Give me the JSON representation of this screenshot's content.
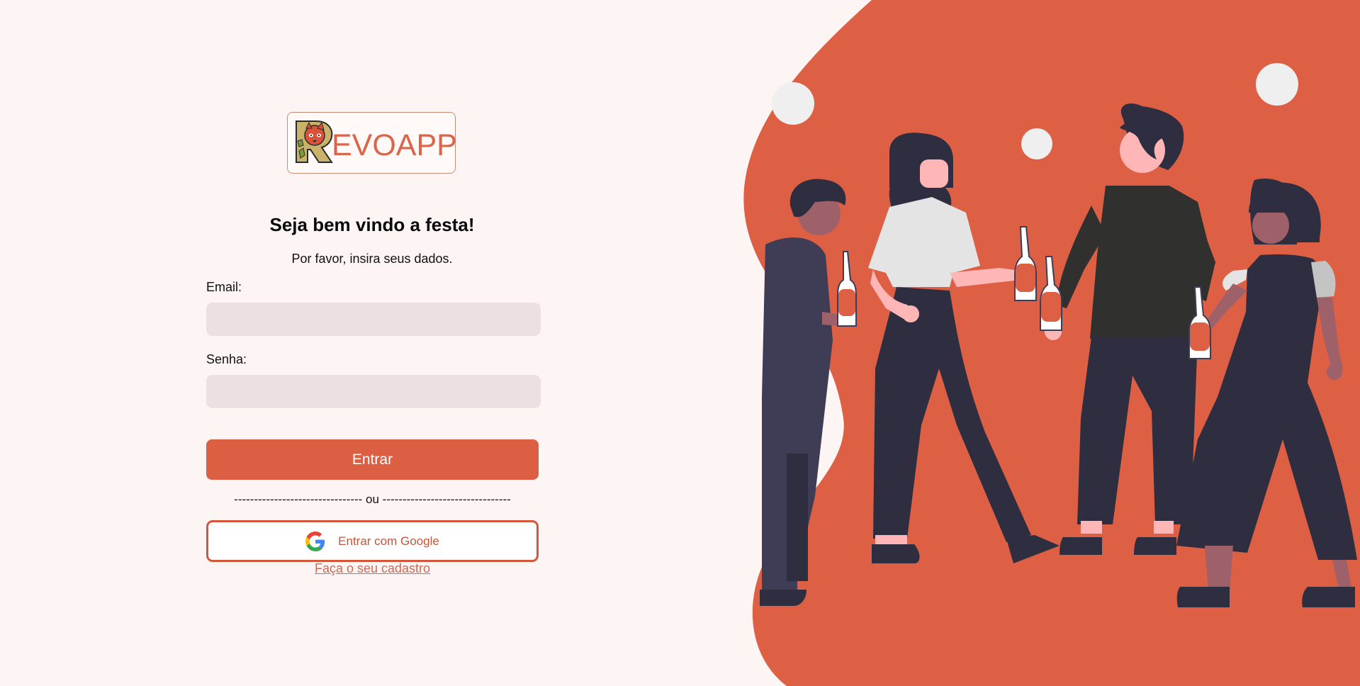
{
  "brand": {
    "logo_text": "EVOAPP",
    "accent_color": "#dc5f44",
    "background_color": "#fdf4f4"
  },
  "login": {
    "heading": "Seja bem vindo a festa!",
    "subtitle": "Por favor, insira seus dados.",
    "email_label": "Email:",
    "email_value": "",
    "password_label": "Senha:",
    "password_value": "",
    "submit_label": "Entrar",
    "divider_text": "-------------------------------- ou --------------------------------",
    "google_label": "Entrar com Google",
    "signup_link": "Faça o seu cadastro"
  },
  "icons": {
    "google": "google-g-logo",
    "logo_mark": "red-panda-r-logo"
  }
}
